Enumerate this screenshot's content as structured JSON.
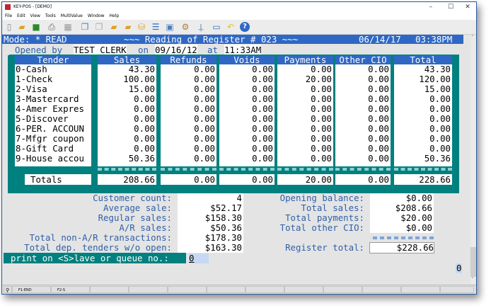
{
  "window": {
    "title": "KEY-POS - [DEMO]",
    "controls": [
      "–",
      "☐",
      "✕"
    ]
  },
  "menu": [
    "File",
    "Edit",
    "View",
    "Tools",
    "MultiValue",
    "Window",
    "Help"
  ],
  "toolbar_icons": [
    "new-icon",
    "open-icon",
    "save-icon",
    "print-icon",
    "calculator-icon",
    "copy-icon",
    "paste-icon",
    "folder-export-icon",
    "folder-import-icon",
    "database-icon",
    "list-icon",
    "screen-icon",
    "settings-icon",
    "pin-icon",
    "monitor-icon",
    "undo-icon",
    "help-icon"
  ],
  "mode_bar": {
    "mode": "Mode: * READ",
    "title": "~~~ Reading of Register # 023 ~~~",
    "date": "06/14/17",
    "time": "03:38PM"
  },
  "opened": {
    "label_by": "Opened by",
    "clerk": "TEST CLERK",
    "label_on": "on",
    "date": "09/16/12",
    "label_at": "at",
    "time": "11:33AM"
  },
  "table": {
    "headers": [
      "Tender",
      "Sales",
      "Refunds",
      "Voids",
      "Payments",
      "Other CIO",
      "Total"
    ],
    "rows": [
      [
        "0-Cash",
        "43.30",
        "0.00",
        "0.00",
        "0.00",
        "0.00",
        "43.30"
      ],
      [
        "1-Check",
        "100.00",
        "0.00",
        "0.00",
        "20.00",
        "0.00",
        "120.00"
      ],
      [
        "2-Visa",
        "15.00",
        "0.00",
        "0.00",
        "0.00",
        "0.00",
        "15.00"
      ],
      [
        "3-Mastercard",
        "0.00",
        "0.00",
        "0.00",
        "0.00",
        "0.00",
        "0.00"
      ],
      [
        "4-Amer Expres",
        "0.00",
        "0.00",
        "0.00",
        "0.00",
        "0.00",
        "0.00"
      ],
      [
        "5-Discover",
        "0.00",
        "0.00",
        "0.00",
        "0.00",
        "0.00",
        "0.00"
      ],
      [
        "6-PER. ACCOUN",
        "0.00",
        "0.00",
        "0.00",
        "0.00",
        "0.00",
        "0.00"
      ],
      [
        "7-Mfgr coupon",
        "0.00",
        "0.00",
        "0.00",
        "0.00",
        "0.00",
        "0.00"
      ],
      [
        "8-Gift Card",
        "0.00",
        "0.00",
        "0.00",
        "0.00",
        "0.00",
        "0.00"
      ],
      [
        "9-House accou",
        "50.36",
        "0.00",
        "0.00",
        "0.00",
        "0.00",
        "50.36"
      ]
    ],
    "totals": [
      "Totals",
      "208.66",
      "0.00",
      "0.00",
      "20.00",
      "0.00",
      "228.66"
    ]
  },
  "summary_left": [
    {
      "label": "Customer count:",
      "value": "4"
    },
    {
      "label": "Average sale:",
      "value": "$52.17"
    },
    {
      "label": "Regular sales:",
      "value": "$158.30"
    },
    {
      "label": "A/R sales:",
      "value": "$50.36"
    },
    {
      "label": "Total non-A/R transactions:",
      "value": "$178.30"
    },
    {
      "label": "Total dep. tenders w/o open:",
      "value": "$163.30"
    }
  ],
  "summary_right": [
    {
      "label": "Opening balance:",
      "value": "$0.00"
    },
    {
      "label": "Total sales:",
      "value": "$208.66"
    },
    {
      "label": "Total payments:",
      "value": "$20.00"
    },
    {
      "label": "Total other CIO:",
      "value": "$0.00"
    }
  ],
  "register_total": {
    "label": "Register total:",
    "value": "$228.66"
  },
  "prompt": {
    "label": "print on <S>lave or queue no.:",
    "value": "0"
  },
  "corner_value": "0",
  "status_bar": [
    "F1-END",
    "F2-S"
  ],
  "colors": {
    "mode_bar": "#2f68c4",
    "teal": "#00807f",
    "label_blue": "#2f5fa8"
  }
}
